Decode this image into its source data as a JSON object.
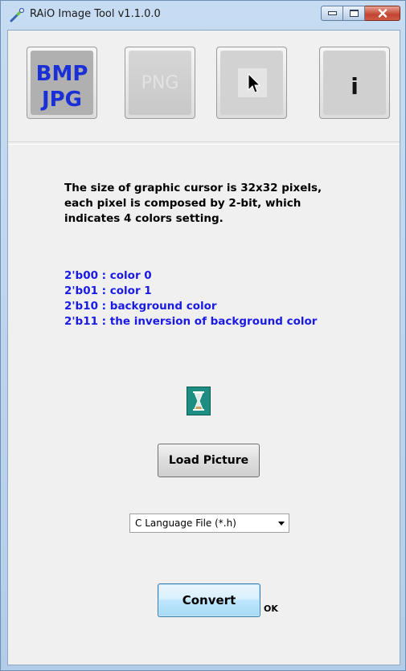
{
  "window": {
    "title": "RAiO Image Tool v1.1.0.0"
  },
  "toolbar": {
    "bmp_jpg_line1": "BMP",
    "bmp_jpg_line2": "JPG",
    "png_label": "PNG",
    "info_label": "i",
    "icons": [
      "wrench-app-icon",
      "cursor-arrow-icon"
    ]
  },
  "content": {
    "description": "The size of graphic cursor is 32x32 pixels, each pixel is composed by 2-bit, which indicates 4 colors setting.",
    "legend": [
      "2'b00 : color 0",
      "2'b01 : color 1",
      "2'b10 : background color",
      "2'b11 : the inversion of background color"
    ],
    "load_button": "Load Picture",
    "file_type_selected": "C Language File (*.h)",
    "convert_button": "Convert",
    "status": "OK"
  },
  "colors": {
    "accent_blue": "#1a1ae6",
    "bmp_text": "#1a2fd6",
    "hourglass_bg": "#1e8e82"
  }
}
